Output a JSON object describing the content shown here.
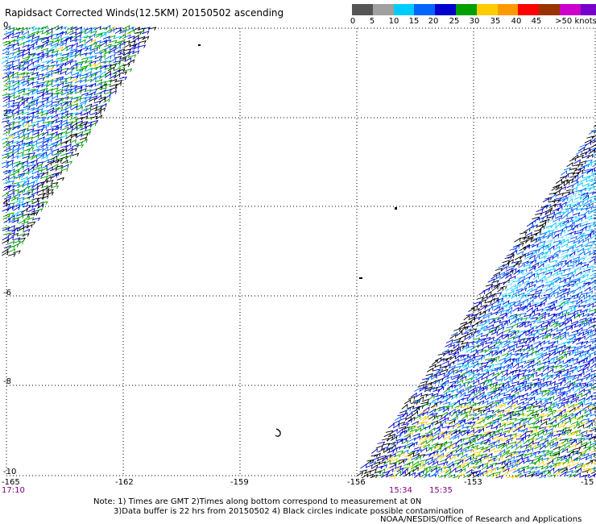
{
  "title": "Rapidsact Corrected Winds(12.5KM) 20150502 ascending",
  "legend": {
    "colors": [
      "#555555",
      "#a0a0a0",
      "#00ccff",
      "#0066ff",
      "#0000cc",
      "#00a000",
      "#ffcc00",
      "#ff9900",
      "#ff0000",
      "#993300",
      "#cc00cc",
      "#7700cc"
    ],
    "labels": [
      "0",
      "5",
      "10",
      "15",
      "20",
      "25",
      "30",
      "35",
      "40",
      "45",
      ">50 knots"
    ]
  },
  "lat_labels": [
    "2",
    "4",
    "-6",
    "-8",
    "-10",
    "0"
  ],
  "lon_labels": [
    "-165",
    "-162",
    "-159",
    "-156",
    "-153",
    "-15"
  ],
  "time_labels": [
    "17:10",
    "15:34",
    "15:35"
  ],
  "notes": {
    "line1": "Note: 1) Times are GMT 2)Times along bottom correspond to measurement at 0N",
    "line2": "3)Data buffer is 22 hrs from 20150502 4) Black circles indicate possible contamination"
  },
  "credit": "NOAA/NESDIS/Office of Research and Applications"
}
